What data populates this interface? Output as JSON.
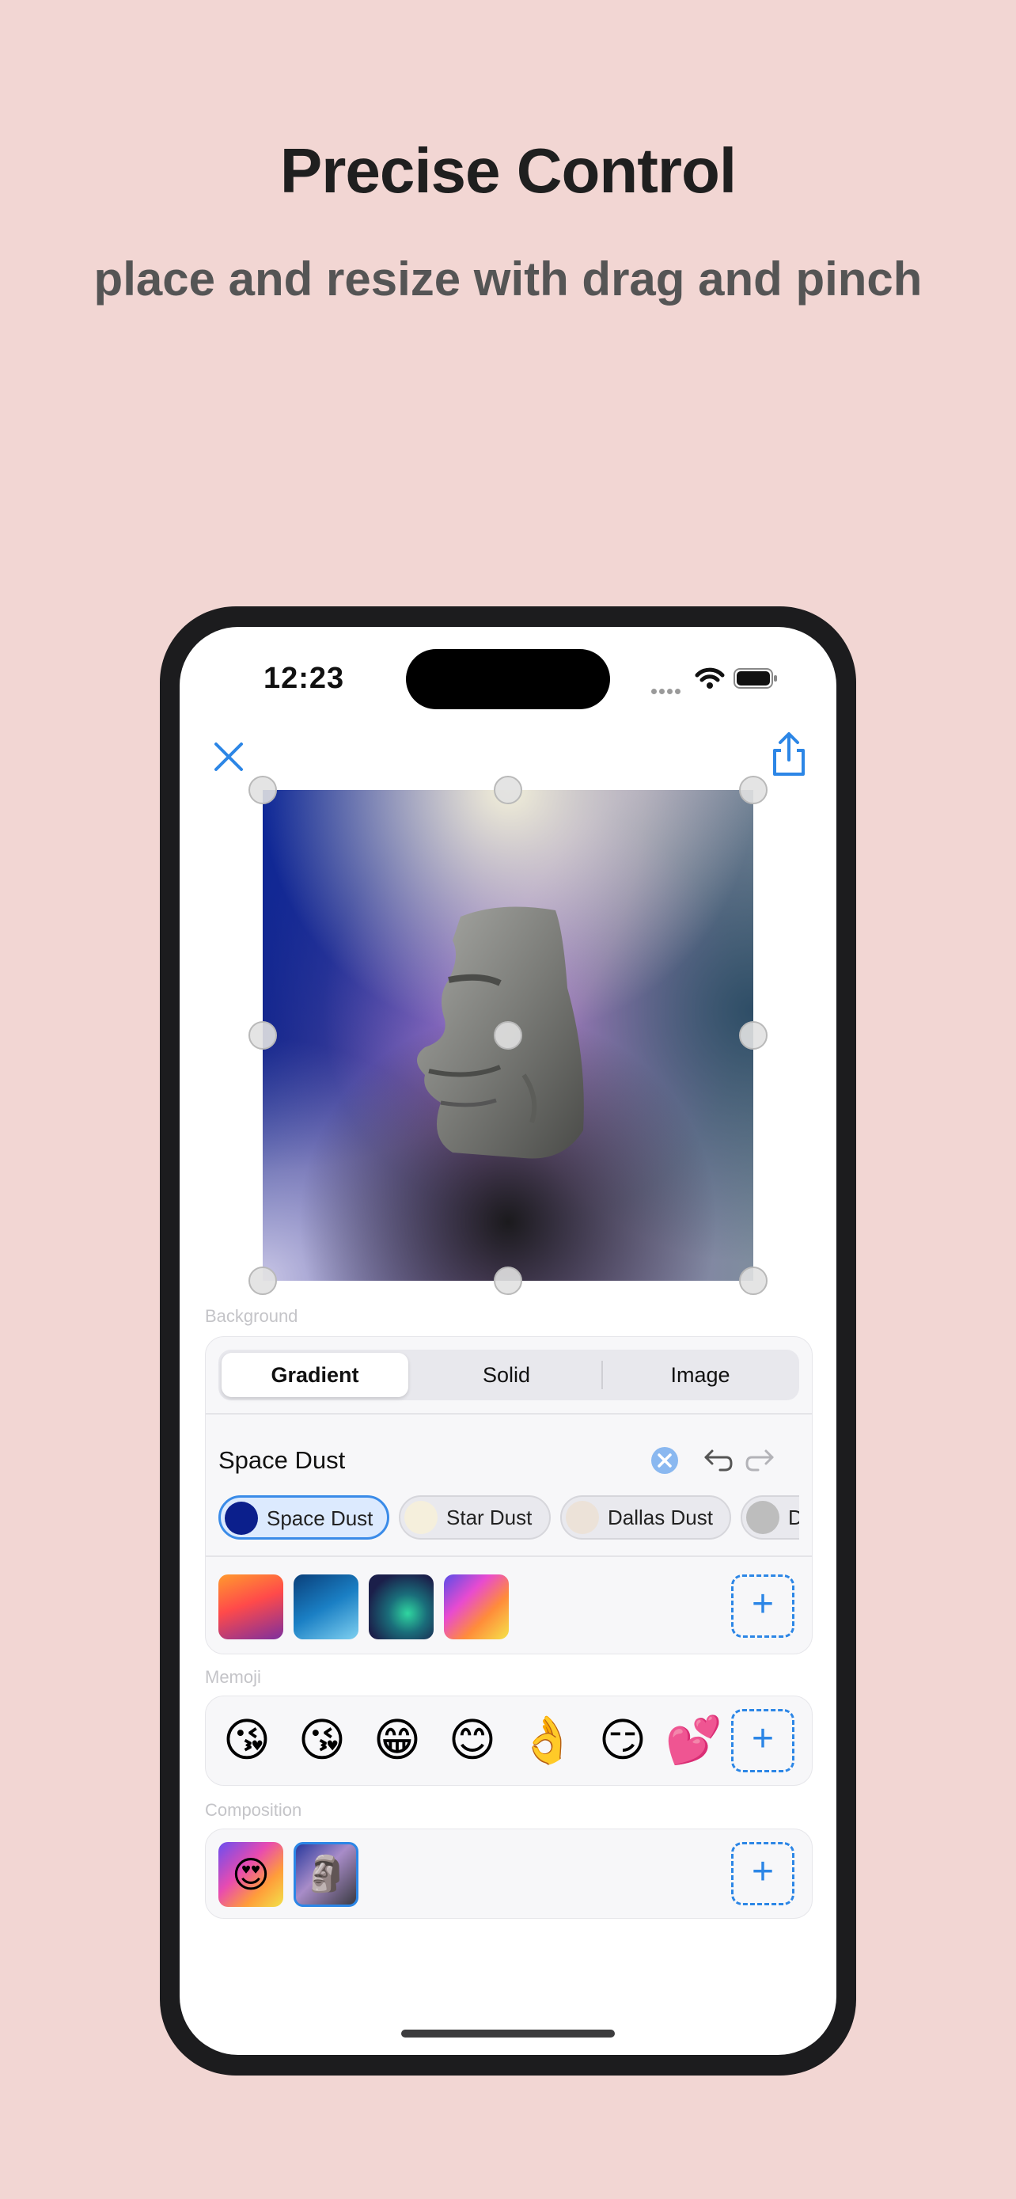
{
  "marketing": {
    "title": "Precise Control",
    "subtitle": "place and resize with drag and pinch"
  },
  "status_bar": {
    "time": "12:23",
    "icons": [
      "wifi-icon",
      "battery-icon"
    ]
  },
  "toolbar": {
    "close_icon": "close-icon",
    "share_icon": "share-icon"
  },
  "background_section": {
    "label": "Background",
    "tabs": [
      {
        "label": "Gradient",
        "selected": true
      },
      {
        "label": "Solid",
        "selected": false
      },
      {
        "label": "Image",
        "selected": false
      }
    ],
    "gradient_name": "Space Dust",
    "presets": [
      {
        "label": "Space Dust",
        "color": "#0b1f8c",
        "selected": true
      },
      {
        "label": "Star Dust",
        "color": "#f5efdc",
        "selected": false
      },
      {
        "label": "Dallas Dust",
        "color": "#ece2d8",
        "selected": false
      },
      {
        "label": "D",
        "color": "#bdbdbd",
        "selected": false
      }
    ],
    "gradient_thumbnails": [
      "sunset",
      "ocean",
      "aurora",
      "rainbow"
    ]
  },
  "memoji_section": {
    "label": "Memoji",
    "items": [
      "😘",
      "😘",
      "😁",
      "😊",
      "👌",
      "😏",
      "💕"
    ]
  },
  "composition_section": {
    "label": "Composition",
    "items": [
      "😍",
      "🗿"
    ]
  },
  "colors": {
    "accent": "#2c86e6",
    "page_bg": "#f2d6d3"
  }
}
